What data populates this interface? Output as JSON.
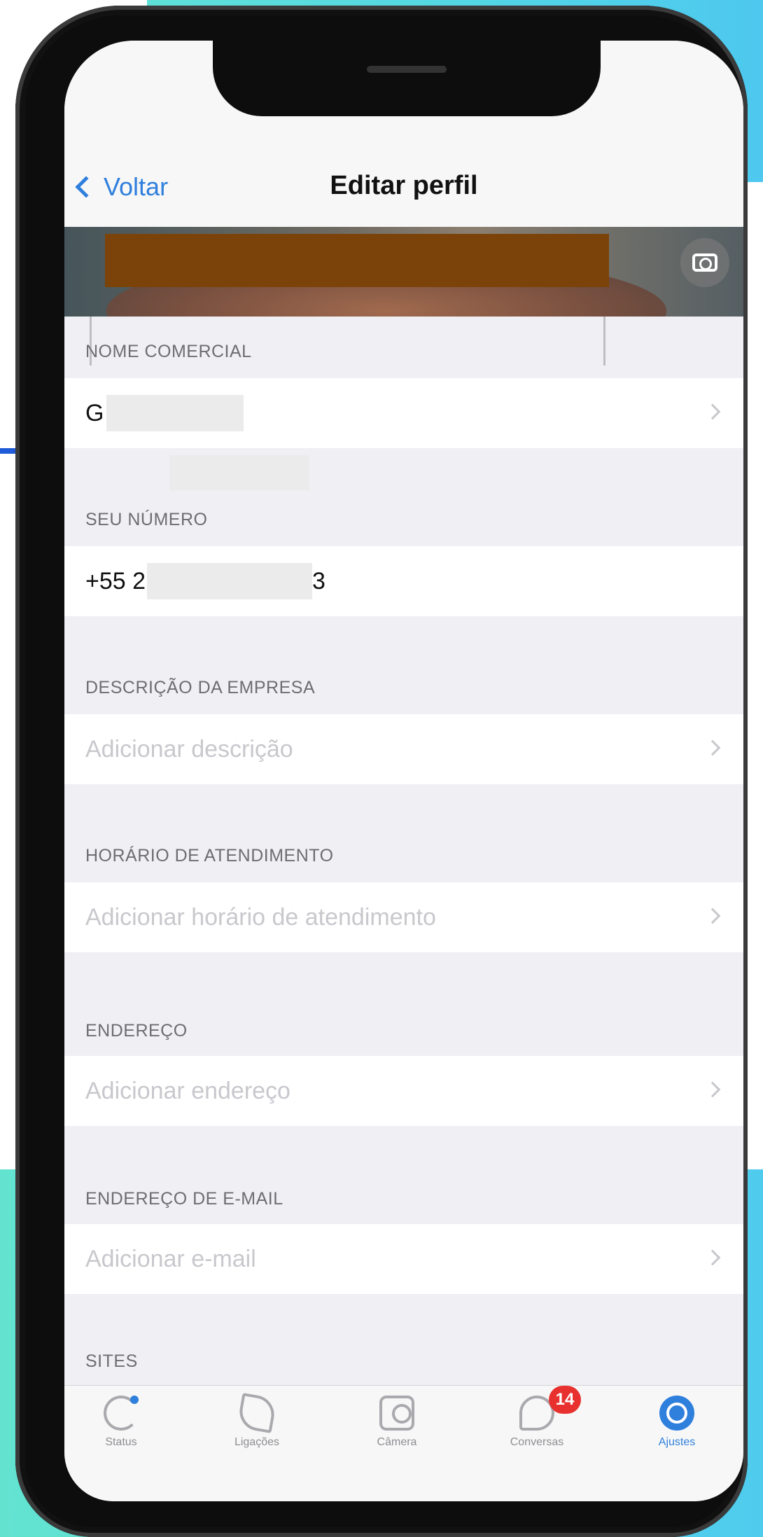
{
  "nav": {
    "back_label": "Voltar",
    "title": "Editar perfil"
  },
  "sections": [
    {
      "id": "nome",
      "header": "NOME COMERCIAL",
      "value": "G",
      "placeholder": "",
      "has_chevron": true
    },
    {
      "id": "numero",
      "header": "SEU NÚMERO",
      "value_prefix": "+55 2",
      "value_suffix": "3",
      "has_chevron": false
    },
    {
      "id": "descricao",
      "header": "DESCRIÇÃO DA EMPRESA",
      "placeholder": "Adicionar descrição",
      "has_chevron": true
    },
    {
      "id": "horario",
      "header": "HORÁRIO DE ATENDIMENTO",
      "placeholder": "Adicionar horário de atendimento",
      "has_chevron": true
    },
    {
      "id": "endereco",
      "header": "ENDEREÇO",
      "placeholder": "Adicionar endereço",
      "has_chevron": true
    },
    {
      "id": "email",
      "header": "ENDEREÇO DE E-MAIL",
      "placeholder": "Adicionar e-mail",
      "has_chevron": true
    },
    {
      "id": "sites",
      "header": "SITES"
    }
  ],
  "tabbar": {
    "tabs": [
      {
        "id": "status",
        "label": "Status",
        "icon": "status-icon"
      },
      {
        "id": "ligacoes",
        "label": "Ligações",
        "icon": "phone-icon"
      },
      {
        "id": "camera",
        "label": "Câmera",
        "icon": "camera-icon"
      },
      {
        "id": "conversas",
        "label": "Conversas",
        "icon": "chat-icon",
        "badge": "14"
      },
      {
        "id": "ajustes",
        "label": "Ajustes",
        "icon": "settings-icon",
        "active": true
      }
    ]
  },
  "colors": {
    "accent": "#2f7fdd",
    "badge": "#e8312f",
    "background": "#efeff4",
    "redaction": "#7b4309"
  }
}
